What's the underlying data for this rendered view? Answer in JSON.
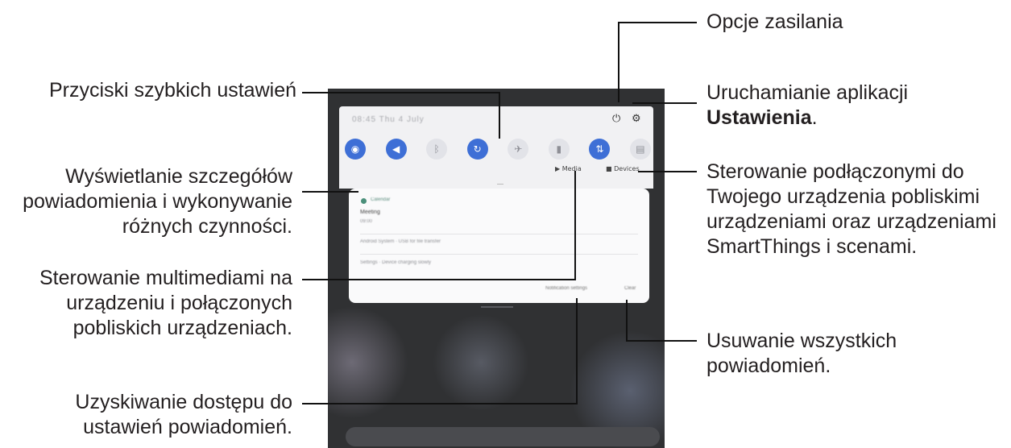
{
  "callouts": {
    "power_options": "Opcje zasilania",
    "quick_settings_buttons": "Przyciski szybkich ustawień",
    "launch_settings_line1": "Uruchamianie aplikacji",
    "launch_settings_bold": "Ustawienia",
    "launch_settings_period": ".",
    "notification_details": [
      "Wyświetlanie szczegółów",
      "powiadomienia i wykonywanie",
      "różnych czynności."
    ],
    "device_control": [
      "Sterowanie podłączonymi do",
      "Twojego urządzenia pobliskimi",
      "urządzeniami oraz urządzeniami",
      "SmartThings i scenami."
    ],
    "media_control": [
      "Sterowanie multimediami na",
      "urządzeniu i połączonych",
      "pobliskich urządzeniach."
    ],
    "clear_all": [
      "Usuwanie wszystkich",
      "powiadomień."
    ],
    "notification_settings": [
      "Uzyskiwanie dostępu do",
      "ustawień powiadomień."
    ]
  },
  "screen": {
    "status_date": "08:45  Thu 4 July",
    "quick_settings": [
      {
        "icon": "wifi-icon",
        "glyph": "◉",
        "active": true
      },
      {
        "icon": "sound-icon",
        "glyph": "◀",
        "active": true
      },
      {
        "icon": "bluetooth-icon",
        "glyph": "ᛒ",
        "active": false
      },
      {
        "icon": "auto-rotate-icon",
        "glyph": "↻",
        "active": true
      },
      {
        "icon": "airplane-mode-icon",
        "glyph": "✈",
        "active": false
      },
      {
        "icon": "flashlight-icon",
        "glyph": "▮",
        "active": false
      },
      {
        "icon": "mobile-data-icon",
        "glyph": "⇅",
        "active": true
      },
      {
        "icon": "screen-mirror-icon",
        "glyph": "▤",
        "active": false
      }
    ],
    "media_label": "Media",
    "devices_label": "Devices",
    "notification": {
      "app_name": "Calendar",
      "title": "Meeting",
      "time": "09:00",
      "row2": "Android System · USB for file transfer",
      "row3": "Settings · Device charging slowly"
    },
    "notification_settings_btn": "Notification settings",
    "clear_btn": "Clear",
    "colors": {
      "accent": "#3e6fd6",
      "panel": "#f1f1f3",
      "screen_bg": "#303133"
    }
  }
}
